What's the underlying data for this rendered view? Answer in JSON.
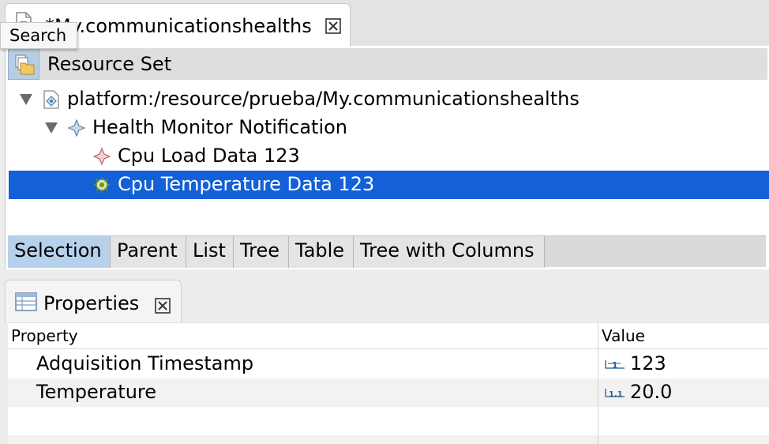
{
  "editor": {
    "tab_title": "*My.communicationshealths",
    "tooltip": "Search",
    "resource_set_label": "Resource Set",
    "tree": [
      {
        "label": "platform:/resource/prueba/My.communicationshealths",
        "level": 0,
        "expanded": true,
        "icon": "model-file-icon"
      },
      {
        "label": "Health Monitor Notification",
        "level": 1,
        "expanded": true,
        "icon": "diamond-blue-icon"
      },
      {
        "label": "Cpu Load Data 123",
        "level": 2,
        "icon": "diamond-red-icon"
      },
      {
        "label": "Cpu Temperature Data 123",
        "level": 2,
        "selected": true,
        "icon": "gear-green-icon"
      }
    ],
    "viewer_tabs": [
      "Selection",
      "Parent",
      "List",
      "Tree",
      "Table",
      "Tree with Columns"
    ],
    "active_viewer_tab": "Selection"
  },
  "properties": {
    "tab_title": "Properties",
    "columns": [
      "Property",
      "Value"
    ],
    "rows": [
      {
        "name": "Adquisition Timestamp",
        "value": "123",
        "icon": "integer-icon"
      },
      {
        "name": "Temperature",
        "value": "20.0",
        "icon": "float-icon"
      }
    ]
  },
  "colors": {
    "selection": "#1460d7",
    "active_tab": "#b7d0ec"
  }
}
